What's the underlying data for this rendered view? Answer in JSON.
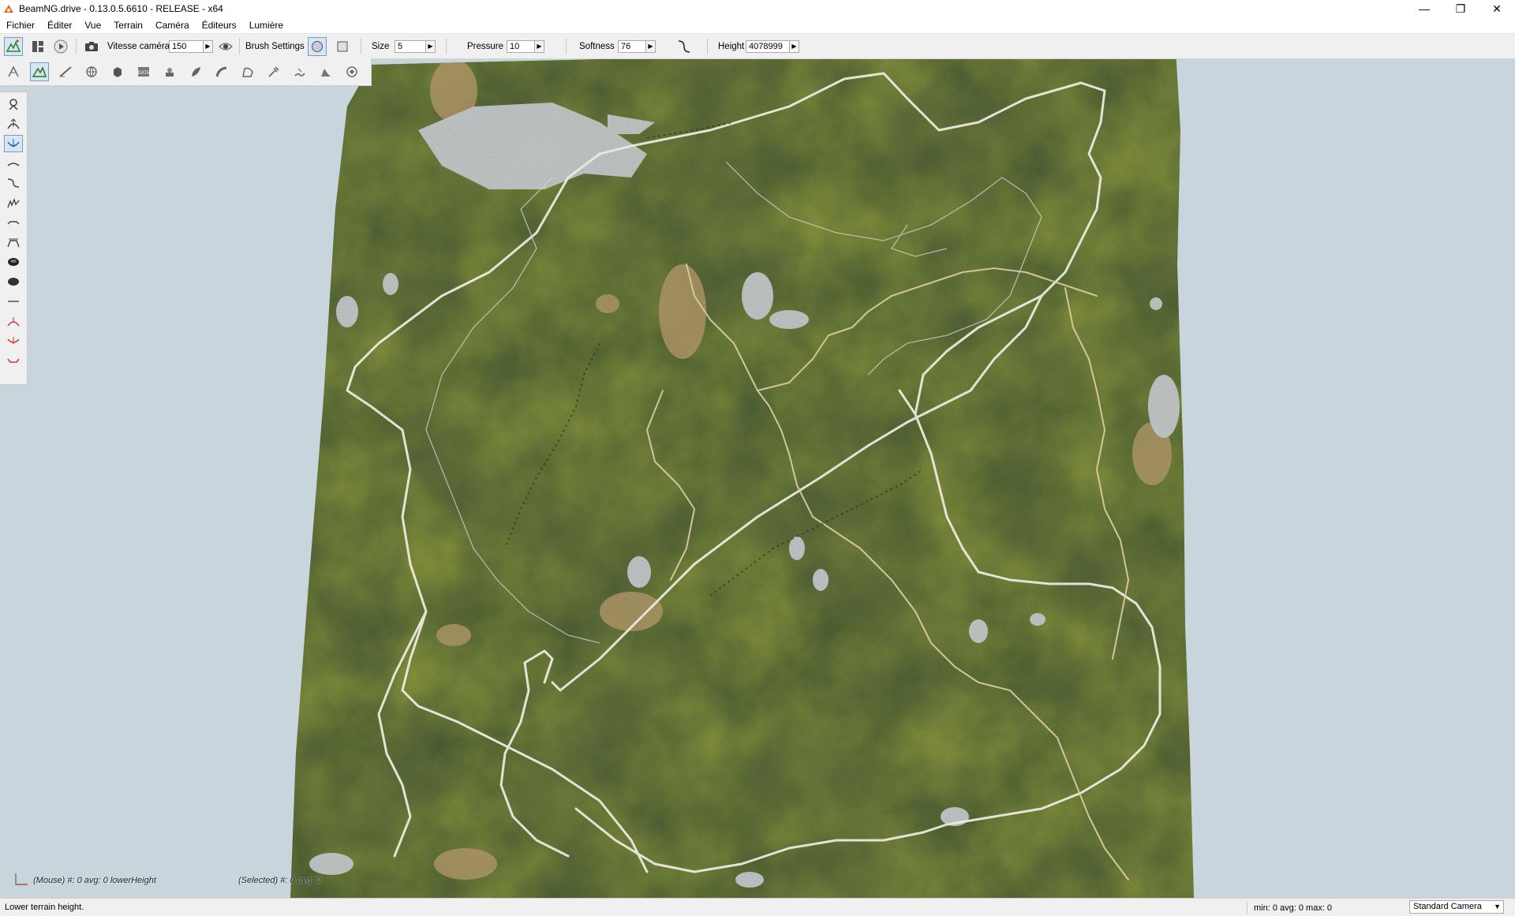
{
  "window": {
    "title": "BeamNG.drive - 0.13.0.5.6610 - RELEASE - x64",
    "controls": {
      "minimize": "—",
      "maximize": "❐",
      "close": "✕"
    }
  },
  "menu": [
    "Fichier",
    "Éditer",
    "Vue",
    "Terrain",
    "Caméra",
    "Éditeurs",
    "Lumière"
  ],
  "toolbar": {
    "camera_speed_label": "Vitesse caméra",
    "camera_speed_value": "150",
    "brush_settings_label": "Brush Settings",
    "size_label": "Size",
    "size_value": "5",
    "pressure_label": "Pressure",
    "pressure_value": "10",
    "softness_label": "Softness",
    "softness_value": "76",
    "height_label": "Height",
    "height_value": "4078999"
  },
  "viewport": {
    "mouse_info": "(Mouse) #: 0  avg: 0 lowerHeight",
    "selected_info": "(Selected) #: 0  avg: 0"
  },
  "status": {
    "message": "Lower terrain height.",
    "stats": "min: 0  avg: 0  max: 0",
    "camera": "Standard Camera"
  },
  "colors": {
    "viewport_bg": "#c9d5dc",
    "dark_forest": "#4f6438",
    "light_grass": "#96a443",
    "dirt": "#c2a773",
    "snow": "#d9dde0",
    "road": "#ece9dc",
    "active_button": "#d7e6f4"
  }
}
